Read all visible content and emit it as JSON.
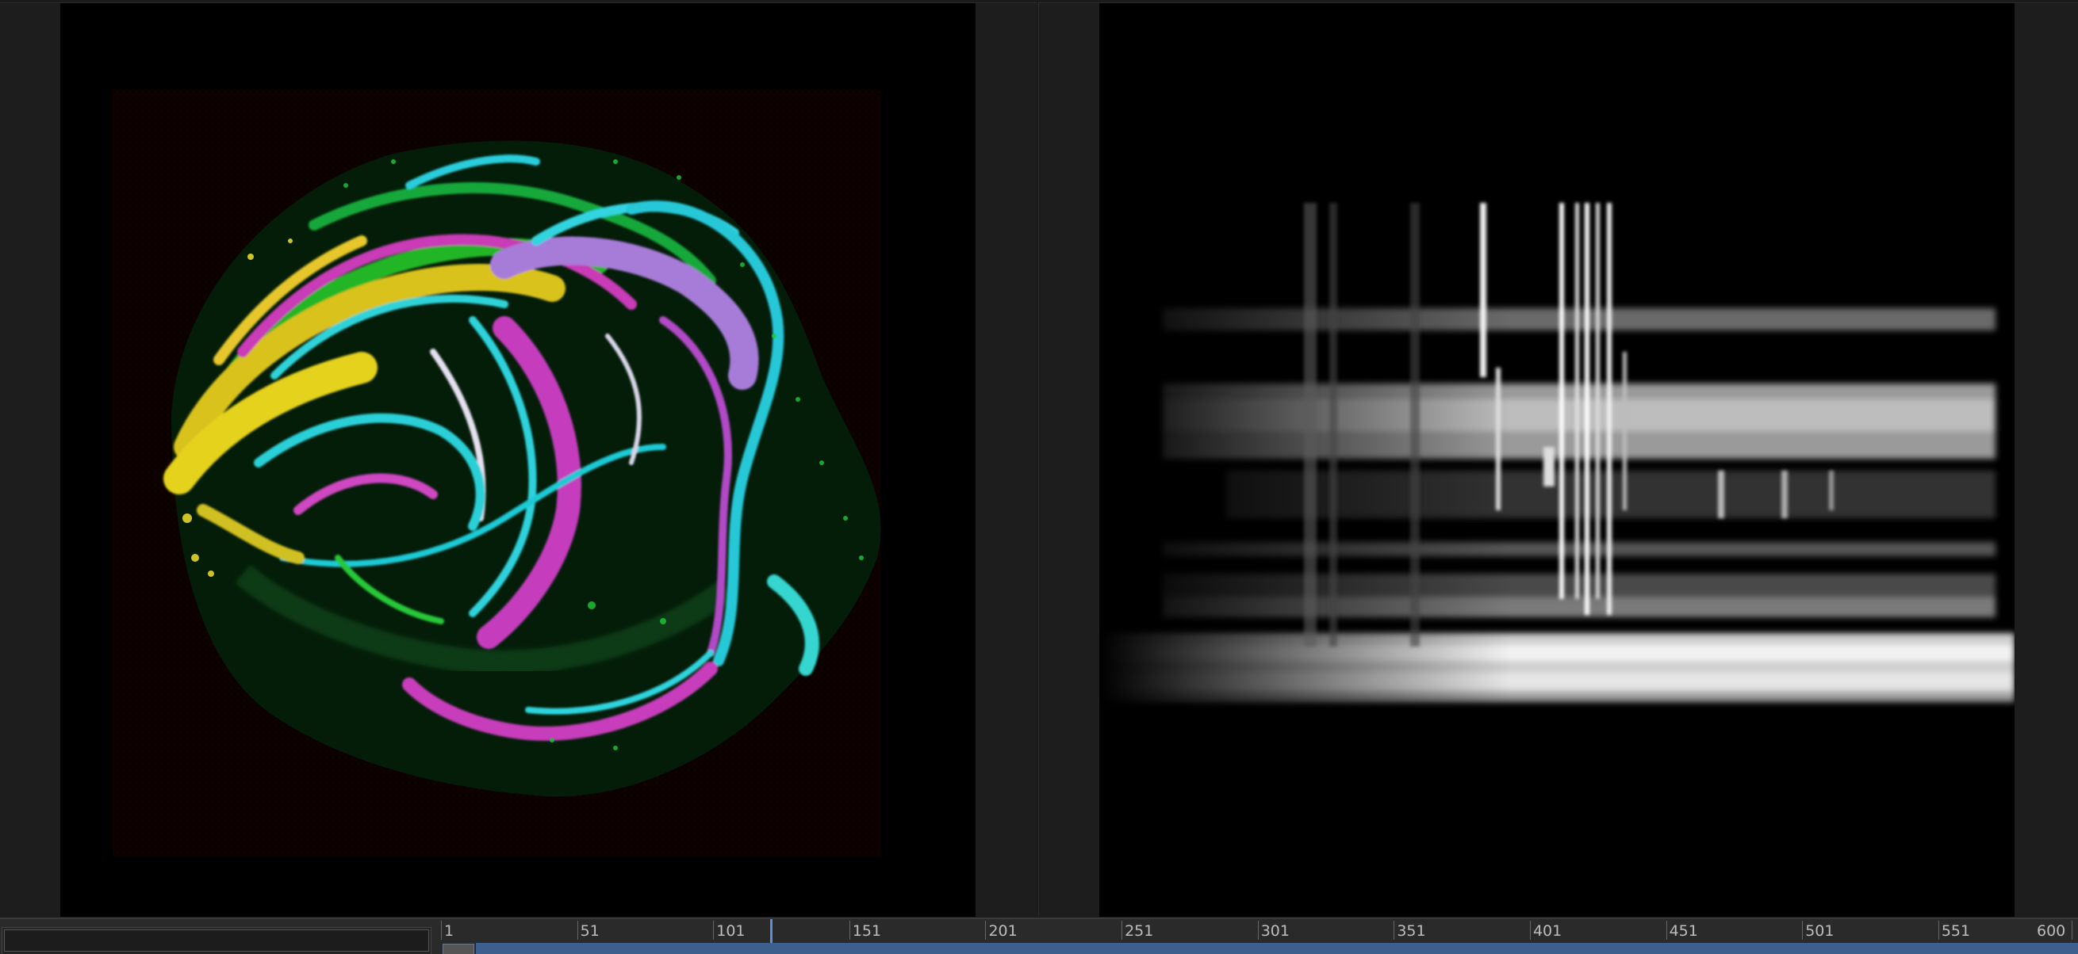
{
  "timeline": {
    "ticks": [
      "1",
      "51",
      "101",
      "151",
      "201",
      "251",
      "301",
      "351",
      "401",
      "451",
      "501",
      "551",
      "600"
    ],
    "range": [
      1,
      600
    ],
    "current_frame": 122,
    "playback_progress": 0.203
  },
  "colors": {
    "panel_bg": "#1d1d1d",
    "canvas_bg": "#000000",
    "timeline_bg": "#2a2a2a",
    "playhead": "#5b8fd6",
    "track": "#3c5f8e"
  }
}
